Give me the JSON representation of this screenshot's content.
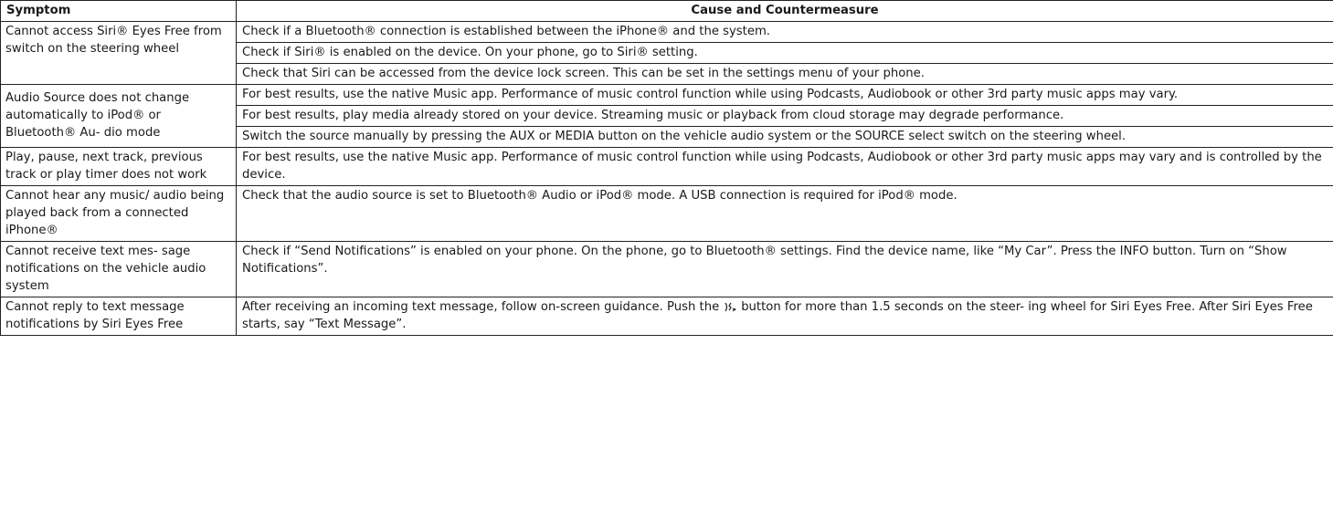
{
  "header": {
    "symptom": "Symptom",
    "cause": "Cause and Countermeasure"
  },
  "rows": [
    {
      "symptom": "Cannot access Siri® Eyes Free from switch on the steering wheel",
      "causes": [
        "Check if a Bluetooth® connection is established between the iPhone® and the system.",
        "Check if Siri® is enabled on the device. On your phone, go to Siri® setting.",
        "Check that Siri can be accessed from the device lock screen. This can be set in the settings menu of your phone."
      ]
    },
    {
      "symptom": "Audio Source does not change automatically to iPod® or Bluetooth® Au- dio mode",
      "causes": [
        "For best results, use the native Music app. Performance of music control function while using Podcasts, Audiobook or other 3rd party music apps may vary.",
        "For best results, play media already stored on your device. Streaming music or playback from cloud storage may degrade performance.",
        "Switch the source manually by pressing the AUX or MEDIA button on the vehicle audio system or the SOURCE select switch on the steering wheel."
      ]
    },
    {
      "symptom": "Play, pause, next track, previous track or play timer does not work",
      "causes": [
        "For best results, use the native Music app. Performance of music control function while using Podcasts, Audiobook or other 3rd party music apps may vary and is controlled by the device."
      ]
    },
    {
      "symptom": "Cannot hear any music/ audio being played back from a connected iPhone®",
      "causes": [
        "Check that the audio source is set to Bluetooth® Audio or iPod® mode. A USB connection is required for iPod® mode."
      ]
    },
    {
      "symptom": "Cannot receive text mes- sage notifications on the vehicle audio system",
      "causes": [
        "Check if “Send Notifications” is enabled on your phone. On the phone, go to Bluetooth® settings. Find the device name, like “My Car”. Press the INFO button. Turn on “Show Notifications”."
      ]
    },
    {
      "symptom": "Cannot reply to text message notifications by Siri Eyes Free",
      "cause_before_icon": "After receiving an incoming text message, follow on-screen guidance. Push the",
      "cause_icon": "voice-command-icon",
      "cause_after_icon": "button for more than 1.5 seconds on the steer- ing wheel for Siri Eyes Free. After Siri Eyes Free starts, say “Text Message”."
    }
  ]
}
